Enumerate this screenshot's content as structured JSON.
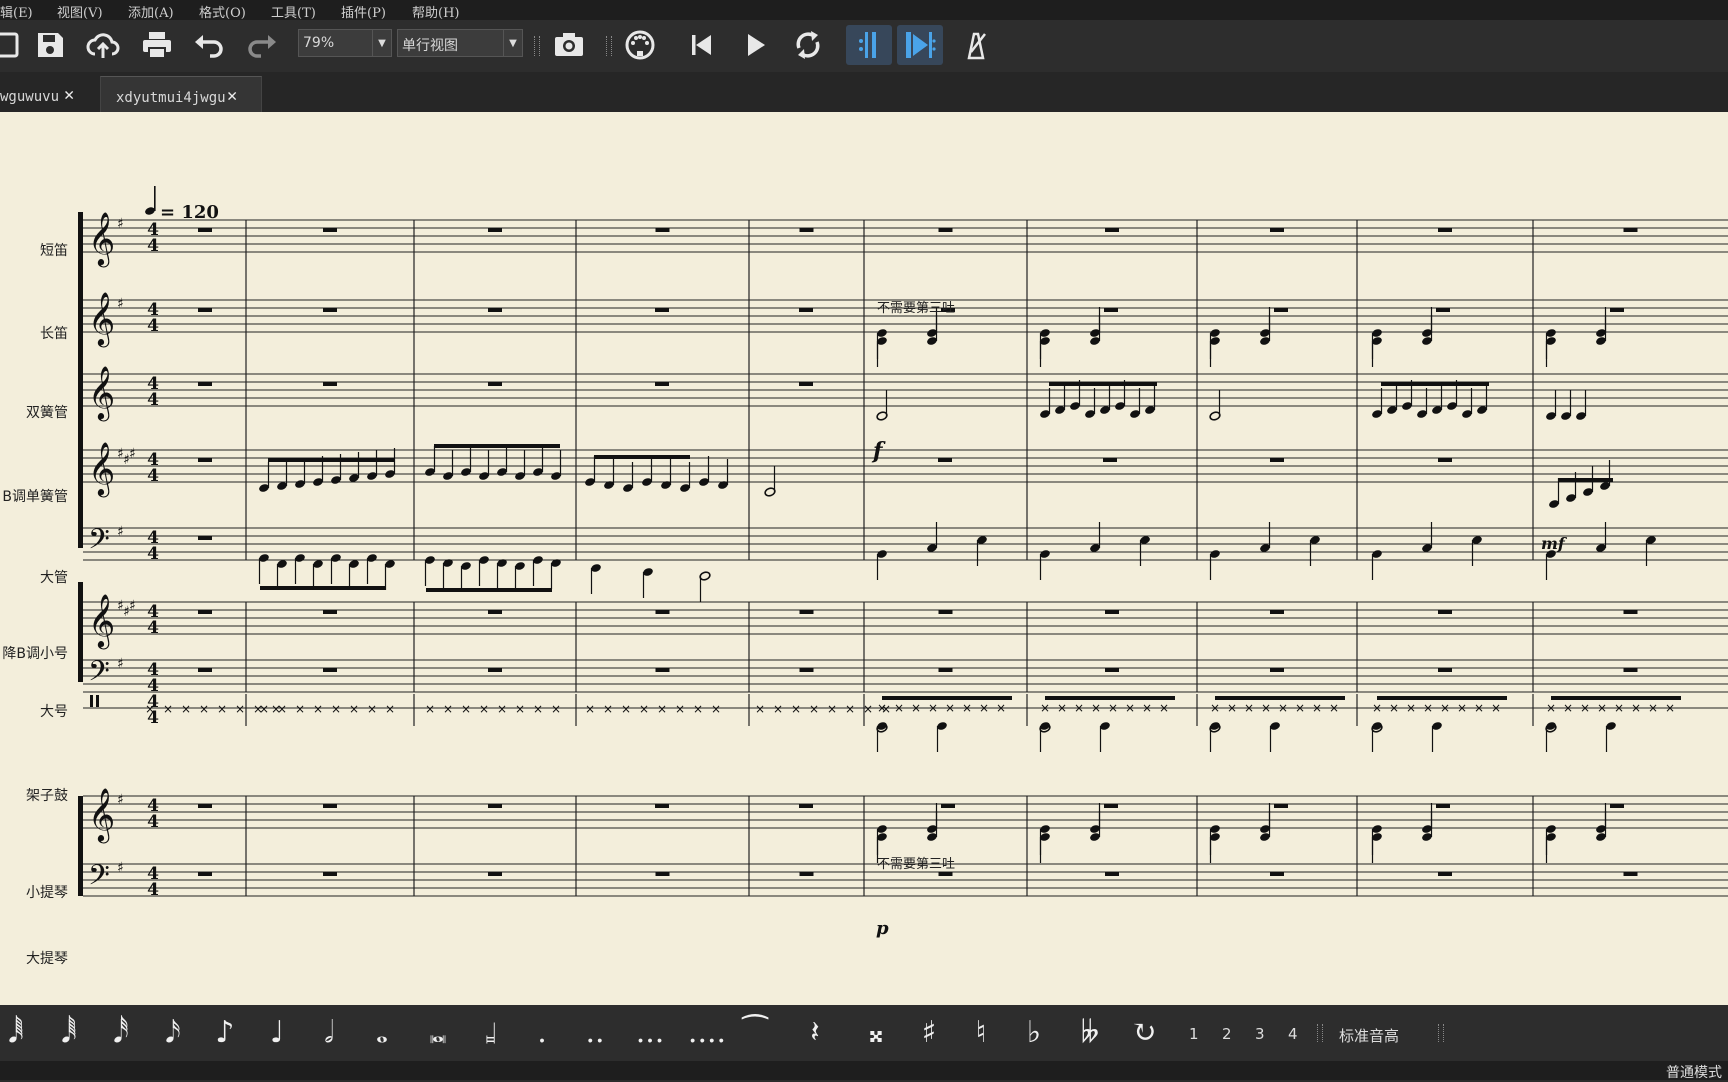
{
  "menu": [
    "辑(E)",
    "视图(V)",
    "添加(A)",
    "格式(O)",
    "工具(T)",
    "插件(P)",
    "帮助(H)"
  ],
  "toolbar": {
    "zoom": "79%",
    "view_mode": "单行视图"
  },
  "tabs": [
    {
      "label": "wguwuvu",
      "active": false
    },
    {
      "label": "xdyutmui4jwgu",
      "active": true
    }
  ],
  "score": {
    "tempo": "= 120",
    "instruments": [
      "短笛",
      "长笛",
      "双簧管",
      "B调单簧管",
      "大管",
      "降B调小号",
      "大号",
      "架子鼓",
      "小提琴",
      "大提琴"
    ],
    "annotations": {
      "flute_text": "不需要第三吐",
      "violin_text": "不需要第三吐",
      "dyn_oboe": "f",
      "dyn_clarinet": "mf",
      "dyn_violin": "p",
      "time_sig": "4"
    }
  },
  "palette": {
    "voices": [
      "1",
      "2",
      "3",
      "4"
    ],
    "pitch_mode": "标准音高"
  },
  "status": {
    "mode": "普通模式"
  },
  "colors": {
    "paper": "#f3eedb",
    "toolbar_bg": "#2d2d2d",
    "accent_active": "#37475a",
    "loop_blue": "#4aa3e8"
  }
}
